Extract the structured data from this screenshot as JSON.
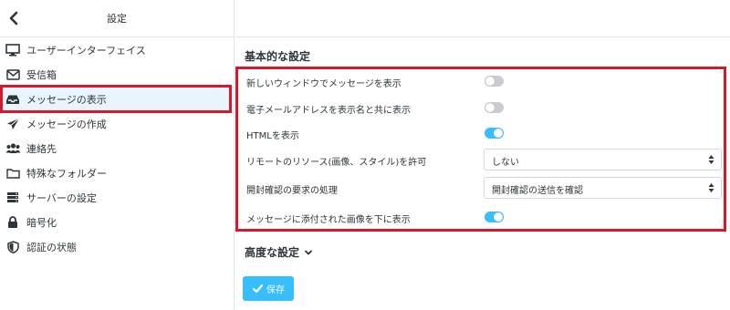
{
  "sidebar": {
    "title": "設定",
    "items": [
      {
        "label": "ユーザーインターフェイス",
        "icon": "monitor-icon"
      },
      {
        "label": "受信箱",
        "icon": "envelope-icon"
      },
      {
        "label": "メッセージの表示",
        "icon": "inbox-tray-icon",
        "selected": true
      },
      {
        "label": "メッセージの作成",
        "icon": "paper-plane-icon"
      },
      {
        "label": "連絡先",
        "icon": "users-icon"
      },
      {
        "label": "特殊なフォルダー",
        "icon": "folder-icon"
      },
      {
        "label": "サーバーの設定",
        "icon": "server-icon"
      },
      {
        "label": "暗号化",
        "icon": "lock-icon"
      },
      {
        "label": "認証の状態",
        "icon": "shield-icon"
      }
    ]
  },
  "main": {
    "section_title": "基本的な設定",
    "settings": {
      "open_new_window": {
        "label": "新しいウィンドウでメッセージを表示",
        "enabled": false
      },
      "show_email_with_name": {
        "label": "電子メールアドレスを表示名と共に表示",
        "enabled": false
      },
      "show_html": {
        "label": "HTMLを表示",
        "enabled": true
      },
      "allow_remote": {
        "label": "リモートのリソース(画像、スタイル)を許可",
        "value": "しない"
      },
      "read_receipt": {
        "label": "開封確認の要求の処理",
        "value": "開封確認の送信を確認"
      },
      "show_attached_images": {
        "label": "メッセージに添付された画像を下に表示",
        "enabled": true
      }
    },
    "advanced_label": "高度な設定",
    "save_label": "保存"
  },
  "colors": {
    "accent": "#37beff",
    "highlight_border": "#d3192b",
    "selected_bg": "#e8f5fd",
    "toggle_off": "#c9cdd1"
  }
}
